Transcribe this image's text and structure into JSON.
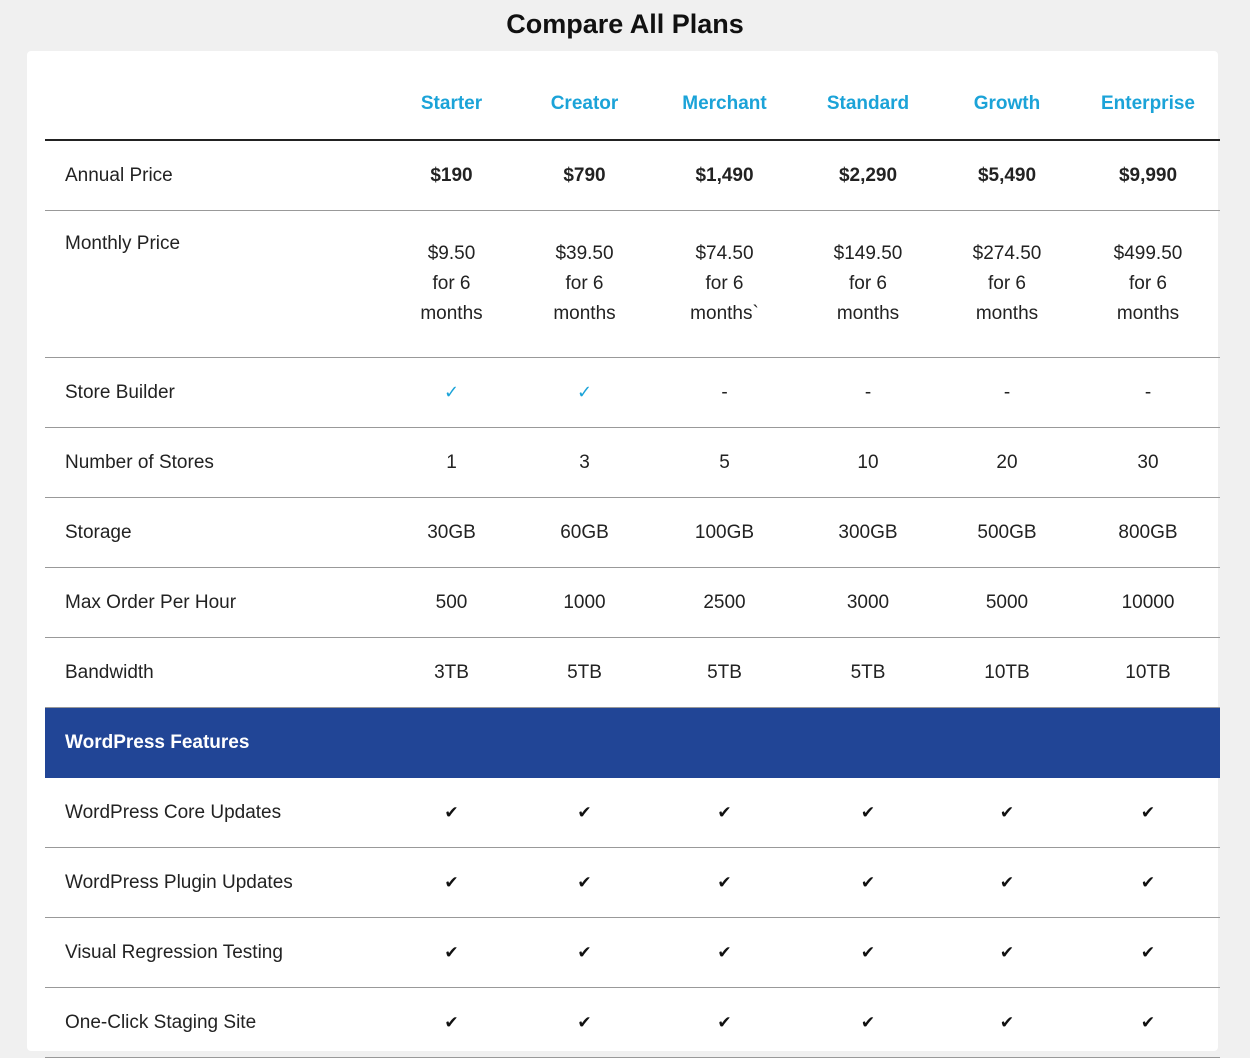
{
  "page": {
    "title": "Compare All Plans"
  },
  "plans": [
    "Starter",
    "Creator",
    "Merchant",
    "Standard",
    "Growth",
    "Enterprise"
  ],
  "rows": [
    {
      "label": "Annual Price",
      "type": "bold",
      "values": [
        "$190",
        "$790",
        "$1,490",
        "$2,290",
        "$5,490",
        "$9,990"
      ]
    },
    {
      "label": "Monthly Price",
      "type": "tall",
      "values": [
        [
          "$9.50",
          "for 6",
          "months"
        ],
        [
          "$39.50",
          "for 6",
          "months"
        ],
        [
          "$74.50",
          "for 6",
          "months`"
        ],
        [
          "$149.50",
          "for 6",
          "months"
        ],
        [
          "$274.50",
          "for 6",
          "months"
        ],
        [
          "$499.50",
          "for 6",
          "months"
        ]
      ]
    },
    {
      "label": "Store Builder",
      "type": "icons",
      "values": [
        "check",
        "check",
        "-",
        "-",
        "-",
        "-"
      ]
    },
    {
      "label": "Number of Stores",
      "type": "text",
      "values": [
        "1",
        "3",
        "5",
        "10",
        "20",
        "30"
      ]
    },
    {
      "label": "Storage",
      "type": "text",
      "values": [
        "30GB",
        "60GB",
        "100GB",
        "300GB",
        "500GB",
        "800GB"
      ]
    },
    {
      "label": "Max Order Per Hour",
      "type": "text",
      "values": [
        "500",
        "1000",
        "2500",
        "3000",
        "5000",
        "10000"
      ]
    },
    {
      "label": "Bandwidth",
      "type": "text",
      "values": [
        "3TB",
        "5TB",
        "5TB",
        "5TB",
        "10TB",
        "10TB"
      ]
    }
  ],
  "section": {
    "title": "WordPress Features",
    "rows": [
      {
        "label": "WordPress Core Updates",
        "values": [
          "check",
          "check",
          "check",
          "check",
          "check",
          "check"
        ]
      },
      {
        "label": "WordPress Plugin Updates",
        "values": [
          "check",
          "check",
          "check",
          "check",
          "check",
          "check"
        ]
      },
      {
        "label": "Visual Regression Testing",
        "values": [
          "check",
          "check",
          "check",
          "check",
          "check",
          "check"
        ]
      },
      {
        "label": "One-Click Staging Site",
        "values": [
          "check",
          "check",
          "check",
          "check",
          "check",
          "check"
        ]
      }
    ]
  },
  "icons": {
    "check": "✔",
    "check_blue": "✓"
  },
  "colors": {
    "accent": "#1ba3d8",
    "section_bg": "#214596"
  }
}
